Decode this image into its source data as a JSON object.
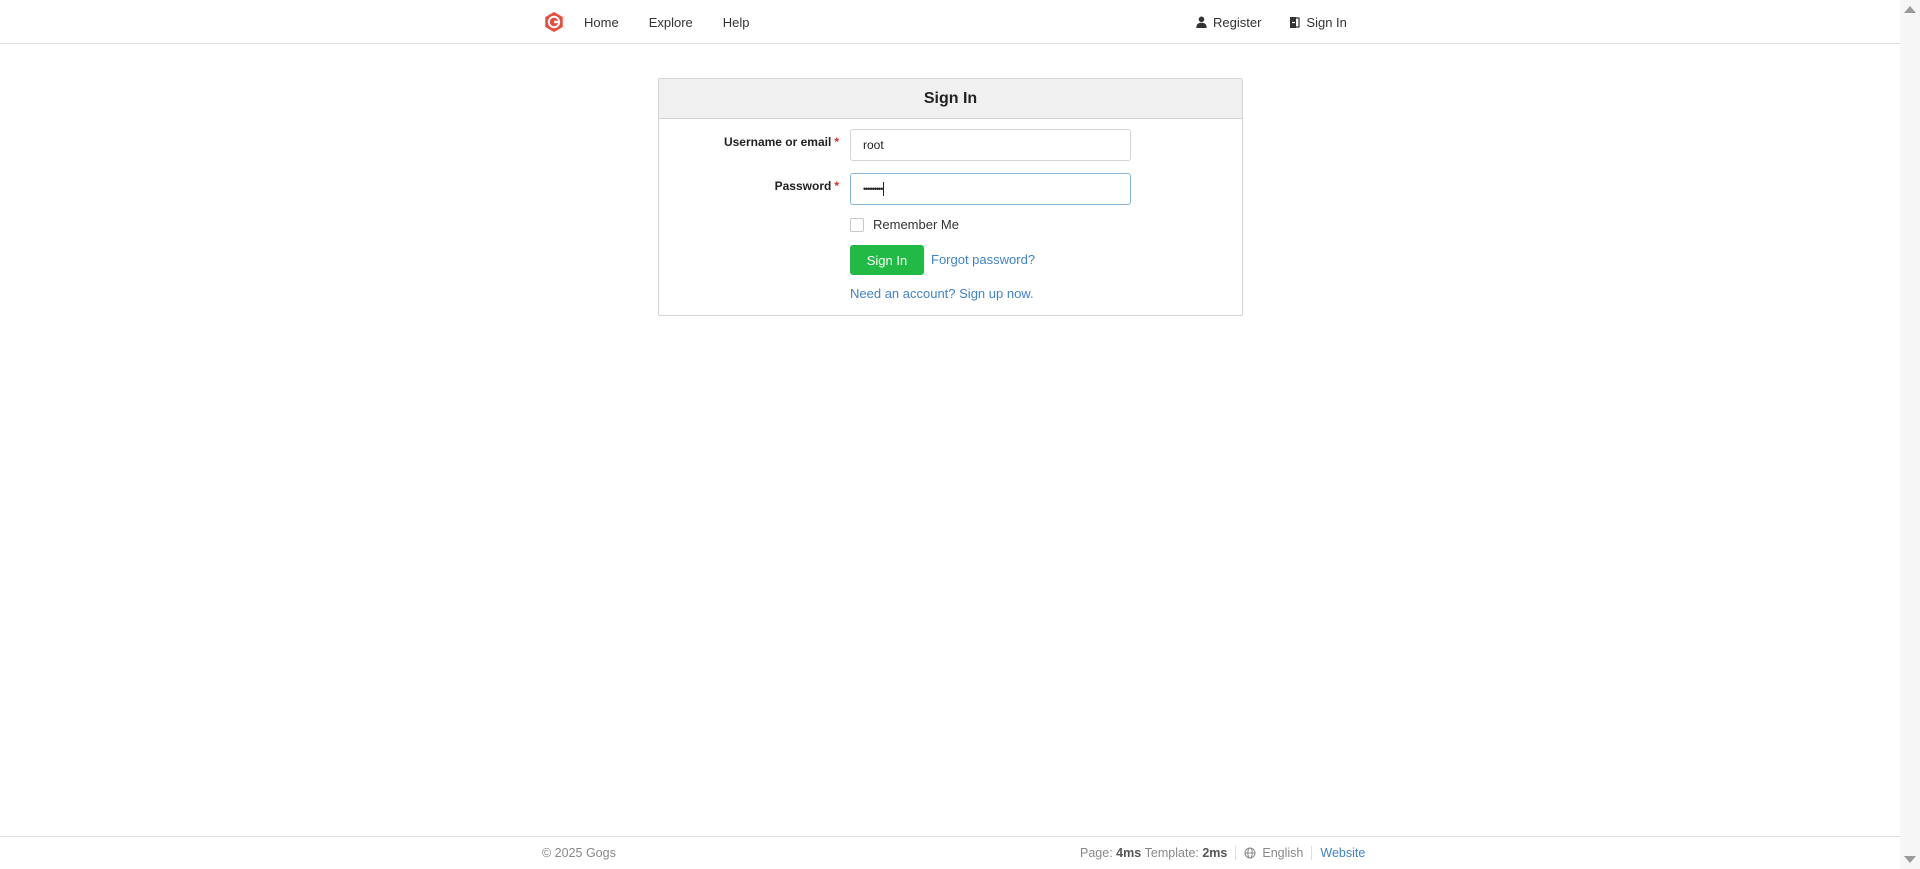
{
  "nav": {
    "home": "Home",
    "explore": "Explore",
    "help": "Help",
    "register": "Register",
    "sign_in": "Sign In"
  },
  "form": {
    "title": "Sign In",
    "username_label": "Username or email",
    "username_value": "root",
    "password_label": "Password",
    "password_mask": "•••••••••",
    "required_mark": "*",
    "remember_me": "Remember Me",
    "submit": "Sign In",
    "forgot_password": "Forgot password?",
    "signup_link": "Need an account? Sign up now."
  },
  "footer": {
    "copyright": "© 2025 Gogs",
    "page_label": "Page:",
    "page_time": "4ms",
    "template_label": "Template:",
    "template_time": "2ms",
    "language": "English",
    "website": "Website"
  },
  "icons": {
    "logo": "gogs-logo-icon",
    "register": "user-icon",
    "sign_in": "sign-in-icon",
    "language": "globe-icon"
  },
  "colors": {
    "primary_button": "#21ba45",
    "link": "#4183c4",
    "logo": "#e74c3c",
    "required": "#db2828"
  }
}
